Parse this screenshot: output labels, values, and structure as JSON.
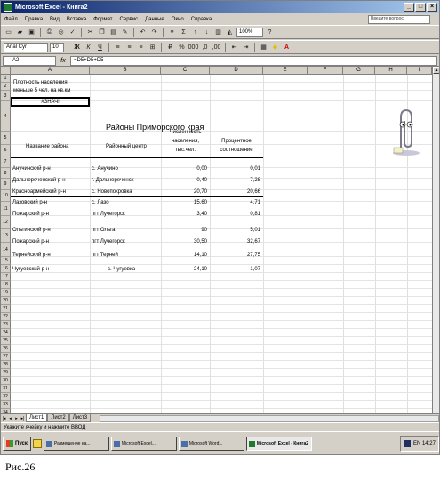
{
  "window": {
    "title": "Microsoft Excel - Книга2"
  },
  "menu": {
    "items": [
      "Файл",
      "Правка",
      "Вид",
      "Вставка",
      "Формат",
      "Сервис",
      "Данные",
      "Окно",
      "Справка"
    ],
    "help_placeholder": "Введите вопрос"
  },
  "toolbar": {
    "font_name": "Arial Cyr",
    "font_size": "10",
    "zoom": "100%"
  },
  "formula_bar": {
    "name_box": "A2",
    "fx": "fx",
    "value": "=D5+D5+D5"
  },
  "columns": [
    "A",
    "B",
    "C",
    "D",
    "E",
    "F",
    "G",
    "H",
    "I"
  ],
  "rows": [
    "1",
    "2",
    "3",
    "4",
    "5",
    "6",
    "7",
    "8",
    "9",
    "10",
    "11",
    "12",
    "13",
    "14",
    "15",
    "16",
    "17",
    "18",
    "19",
    "20",
    "21",
    "22",
    "23",
    "24",
    "25",
    "26",
    "27",
    "28",
    "29",
    "30",
    "31",
    "32",
    "33",
    "34"
  ],
  "sheet": {
    "note_line1": "Плотность населения",
    "note_line2": "меньше 5 чел. на кв.км",
    "selected_value": "#ЗНАЧ!",
    "title": "Районы Приморского края",
    "headers": {
      "district": "Название района",
      "center": "Районный центр",
      "population_l1": "Численность",
      "population_l2": "населения,",
      "population_l3": "тыс.чел.",
      "share_l1": "Процентное",
      "share_l2": "соотношение"
    },
    "rows": [
      {
        "district": "Анучинский р-н",
        "center": "с. Анучино",
        "population": "0,00",
        "share": "0,01"
      },
      {
        "district": "Дальнереченский р-н",
        "center": "г. Дальнереченск",
        "population": "0,40",
        "share": "7,28"
      },
      {
        "district": "Красноармейский р-н",
        "center": "с. Новопокровка",
        "population": "20,70",
        "share": "20,66"
      },
      {
        "district": "Лазовский р-н",
        "center": "с. Лазо",
        "population": "15,60",
        "share": "4,71"
      },
      {
        "district": "Пожарский р-н",
        "center": "пгт Лучегорск",
        "population": "3,40",
        "share": "0,81"
      },
      {
        "district": "Ольгинский р-н",
        "center": "пгт Ольга",
        "population": "90",
        "share": "5,01"
      },
      {
        "district": "Пожарский р-н",
        "center": "пгт Лучегорск",
        "population": "30,50",
        "share": "32,67"
      },
      {
        "district": "Тернейский р-н",
        "center": "пгт Терней",
        "population": "14,10",
        "share": "27,75"
      },
      {
        "district": "Чугуевский р-н",
        "center": "с. Чугуевка",
        "population": "24,10",
        "share": "1,07"
      }
    ]
  },
  "tabs": [
    "Лист1",
    "Лист2",
    "Лист3"
  ],
  "status": {
    "text": "Укажите ячейку и нажмите ВВОД"
  },
  "taskbar": {
    "start": "Пуск",
    "tasks": [
      "Размещение на...",
      "Microsoft Excel...",
      "Microsoft Word...",
      "Microsoft Excel - Книга2"
    ],
    "clock": "EN 14:27"
  },
  "caption": "Рис.26"
}
